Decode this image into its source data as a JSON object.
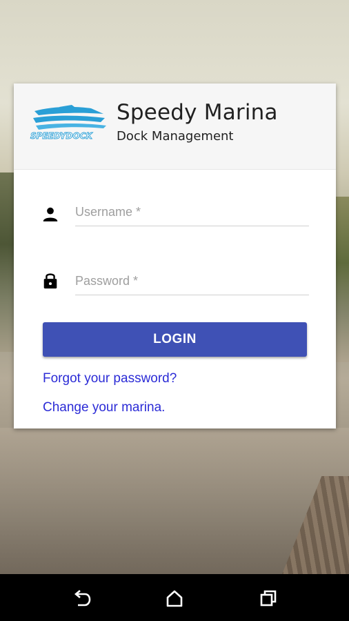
{
  "app": {
    "title": "Speedy Marina",
    "subtitle": "Dock Management",
    "logo_text": "SPEEDYDOCK"
  },
  "form": {
    "username_placeholder": "Username *",
    "username_value": "",
    "password_placeholder": "Password *",
    "password_value": "",
    "login_label": "LOGIN",
    "forgot_password_label": "Forgot your password?",
    "change_marina_label": "Change your marina."
  },
  "icons": {
    "username": "person-icon",
    "password": "lock-icon",
    "nav_back": "back-icon",
    "nav_home": "home-icon",
    "nav_recents": "recents-icon"
  },
  "colors": {
    "primary": "#3f51b5",
    "link": "#2b2bd6",
    "logo_blue": "#2a9fd6"
  }
}
